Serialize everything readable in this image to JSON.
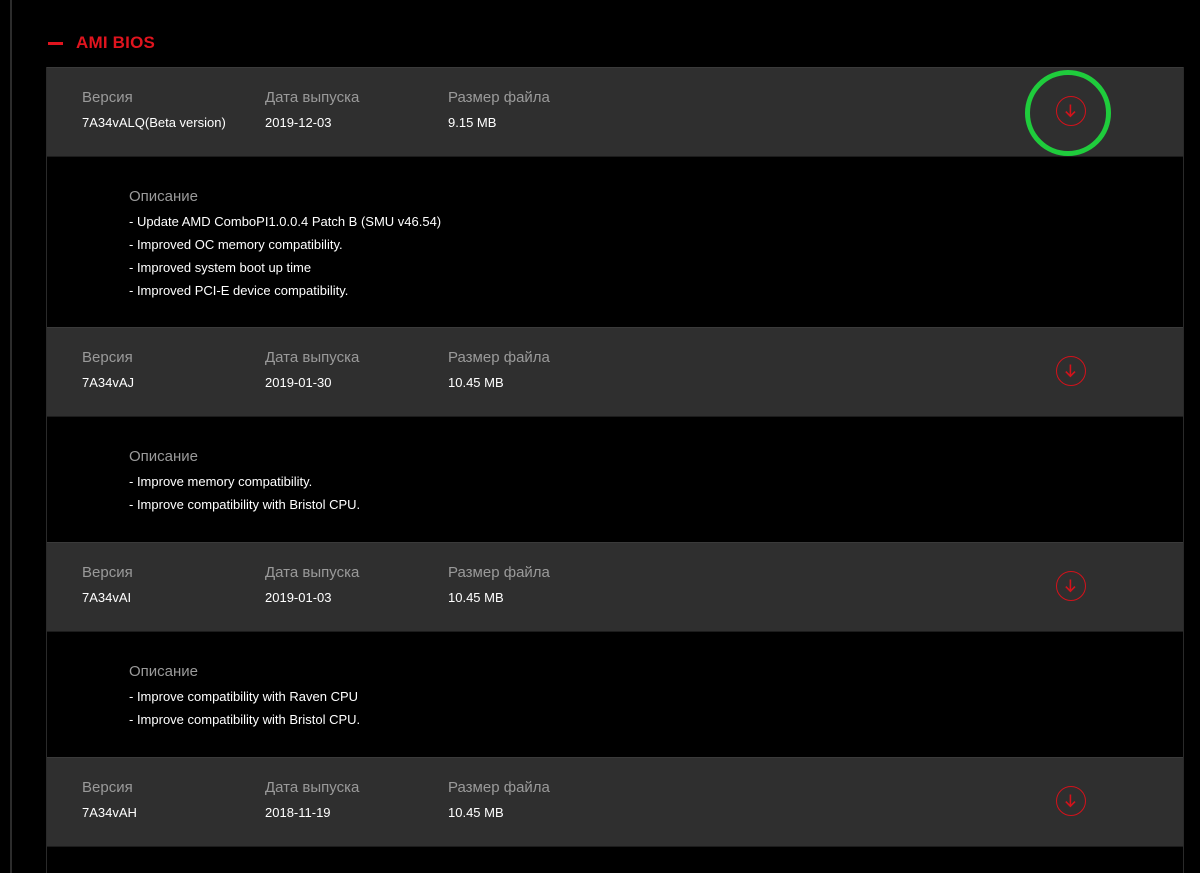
{
  "section": {
    "title": "AMI BIOS"
  },
  "columns": {
    "version": "Версия",
    "date": "Дата выпуска",
    "size": "Размер файла"
  },
  "description_label": "Описание",
  "entries": [
    {
      "version": "7A34vALQ(Beta version)",
      "date": "2019-12-03",
      "size": "9.15 MB",
      "highlighted": true,
      "description": [
        "- Update AMD ComboPI1.0.0.4 Patch B (SMU v46.54)",
        "- Improved OC memory compatibility.",
        "- Improved system boot up time",
        "- Improved PCI-E device compatibility."
      ]
    },
    {
      "version": "7A34vAJ",
      "date": "2019-01-30",
      "size": "10.45 MB",
      "highlighted": false,
      "description": [
        "- Improve memory compatibility.",
        "- Improve compatibility with Bristol CPU."
      ]
    },
    {
      "version": "7A34vAI",
      "date": "2019-01-03",
      "size": "10.45 MB",
      "highlighted": false,
      "description": [
        "- Improve compatibility with Raven CPU",
        "- Improve compatibility with Bristol CPU."
      ]
    },
    {
      "version": "7A34vAH",
      "date": "2018-11-19",
      "size": "10.45 MB",
      "highlighted": false,
      "description": []
    }
  ],
  "colors": {
    "accent": "#e0141e",
    "highlight": "#1fcc3c",
    "row_bg": "#2f2f2f",
    "page_bg": "#000000"
  },
  "icons": {
    "download": "download-arrow-circle-icon"
  }
}
